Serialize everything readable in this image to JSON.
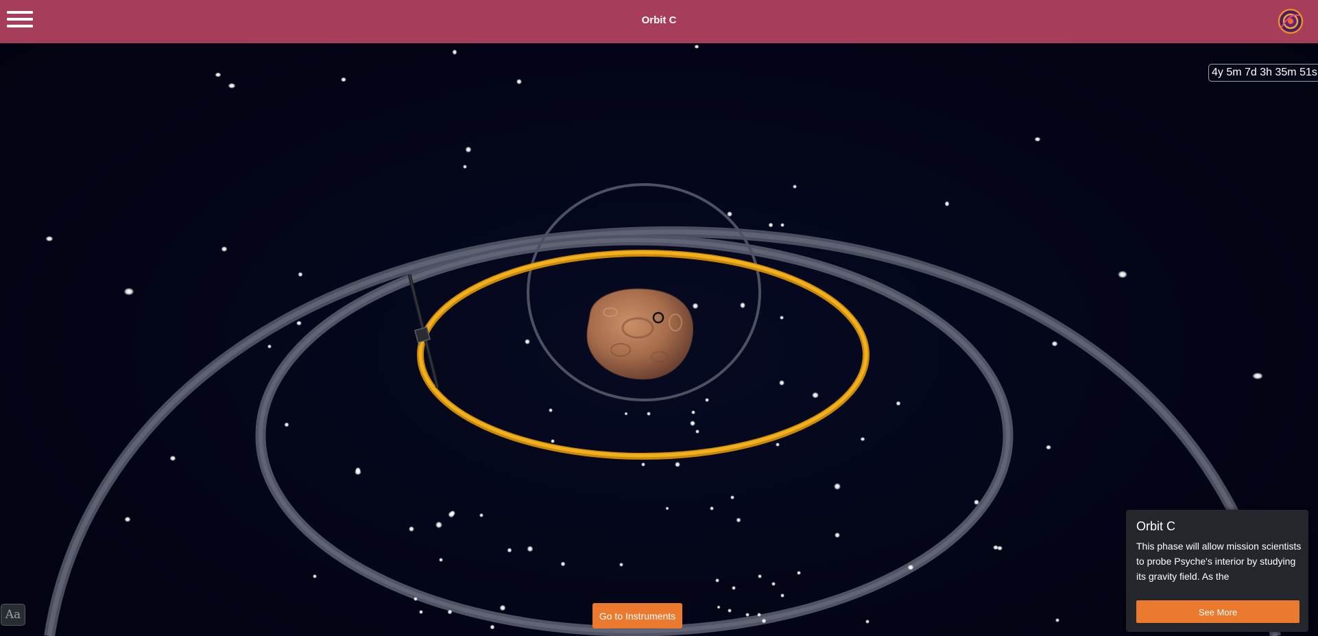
{
  "header": {
    "title": "Orbit C",
    "menu_icon": "hamburger-menu-icon",
    "logo_icon": "psyche-mission-logo"
  },
  "countdown": {
    "text": "4y 5m 7d 3h 35m 51s"
  },
  "accessibility": {
    "font_button_label": "Aa"
  },
  "instruments_button": {
    "label": "Go to Instruments"
  },
  "info_card": {
    "title": "Orbit C",
    "body": "This phase will allow mission scientists to probe Psyche's interior by studying its gravity field. As the",
    "button_label": "See More"
  },
  "colors": {
    "header_bg": "#a63d5b",
    "space_bg": "#030414",
    "active_orbit": "#e6a416",
    "inactive_orbit": "#585b6a",
    "accent_button": "#ec7a2e",
    "card_bg": "#23262b"
  }
}
